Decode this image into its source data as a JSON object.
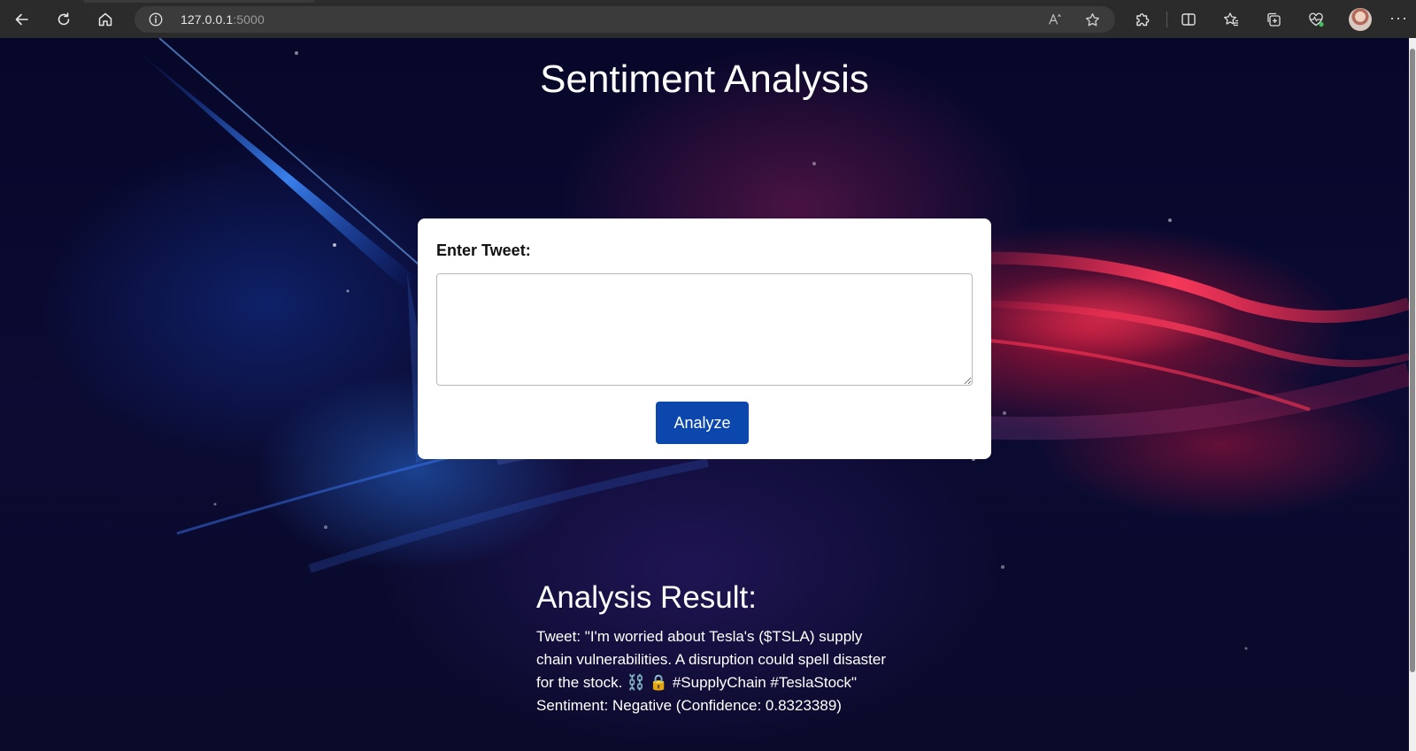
{
  "browser": {
    "url_host": "127.0.0.1",
    "url_port": ":5000",
    "icons": {
      "back": "arrow-left-icon",
      "refresh": "refresh-icon",
      "home": "home-icon",
      "site_info": "info-icon",
      "read_aloud": "read-aloud-icon",
      "favorite": "star-icon",
      "extensions": "puzzle-icon",
      "split_screen": "split-screen-icon",
      "favorites": "favorites-icon",
      "collections": "collections-icon",
      "browser_essentials": "heart-pulse-icon",
      "profile": "avatar",
      "menu": "more-icon"
    },
    "more_glyph": "···"
  },
  "page": {
    "title": "Sentiment Analysis",
    "form": {
      "label": "Enter Tweet:",
      "input_value": "",
      "button_label": "Analyze"
    },
    "result": {
      "heading": "Analysis Result:",
      "tweet_text": "Tweet: \"I'm worried about Tesla's ($TSLA) supply chain vulnerabilities. A disruption could spell disaster for the stock. ⛓️ 🔒 #SupplyChain #TeslaStock\"",
      "sentiment_text": "Sentiment: Negative (Confidence: 0.8323389)"
    }
  },
  "colors": {
    "button": "#0b47ad",
    "card": "#ffffff",
    "background_dark": "#0b0b33",
    "glow_red": "#d21437",
    "glow_blue": "#286edc"
  }
}
